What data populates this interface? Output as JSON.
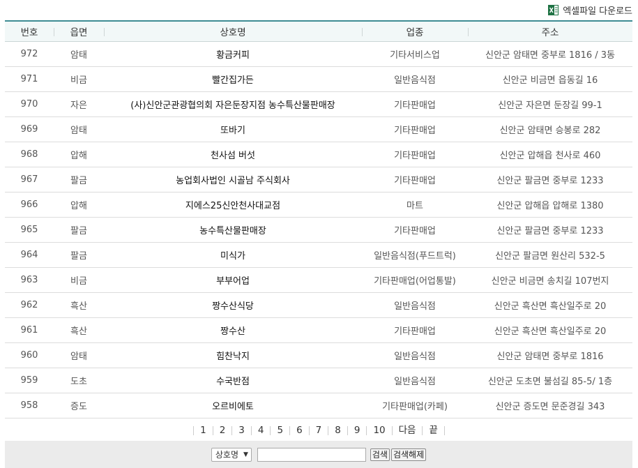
{
  "excel": {
    "label": "엑셀파일 다운로드",
    "icon": "excel-icon",
    "color": "#1f7244"
  },
  "columns": [
    "번호",
    "읍면",
    "상호명",
    "업종",
    "주소"
  ],
  "rows": [
    {
      "num": "972",
      "area": "암태",
      "name": "황금커피",
      "type": "기타서비스업",
      "addr": "신안군 암태면 중부로 1816 / 3동"
    },
    {
      "num": "971",
      "area": "비금",
      "name": "빨간집가든",
      "type": "일반음식점",
      "addr": "신안군 비금면 읍동길 16"
    },
    {
      "num": "970",
      "area": "자은",
      "name": "(사)신안군관광협의회 자은둔장지점 농수특산물판매장",
      "type": "기타판매업",
      "addr": "신안군 자은면 둔장길 99-1"
    },
    {
      "num": "969",
      "area": "암태",
      "name": "또바기",
      "type": "기타판매업",
      "addr": "신안군 암태면 승봉로 282"
    },
    {
      "num": "968",
      "area": "압해",
      "name": "천사섬 버섯",
      "type": "기타판매업",
      "addr": "신안군 압해읍 천사로 460"
    },
    {
      "num": "967",
      "area": "팔금",
      "name": "농업회사법인 시골남 주식회사",
      "type": "기타판매업",
      "addr": "신안군 팔금면 중부로 1233"
    },
    {
      "num": "966",
      "area": "압해",
      "name": "지에스25신안천사대교점",
      "type": "마트",
      "addr": "신안군 압해읍 압해로 1380"
    },
    {
      "num": "965",
      "area": "팔금",
      "name": "농수특산물판매장",
      "type": "기타판매업",
      "addr": "신안군 팔금면 중부로 1233"
    },
    {
      "num": "964",
      "area": "팔금",
      "name": "미식가",
      "type": "일반음식점(푸드트럭)",
      "addr": "신안군 팔금면 원산리 532-5"
    },
    {
      "num": "963",
      "area": "비금",
      "name": "부부어업",
      "type": "기타판매업(어업통발)",
      "addr": "신안군 비금면 송치길 107번지"
    },
    {
      "num": "962",
      "area": "흑산",
      "name": "짱수산식당",
      "type": "일반음식점",
      "addr": "신안군 흑산면 흑산일주로 20"
    },
    {
      "num": "961",
      "area": "흑산",
      "name": "짱수산",
      "type": "기타판매업",
      "addr": "신안군 흑산면 흑산일주로 20"
    },
    {
      "num": "960",
      "area": "암태",
      "name": "힘찬낙지",
      "type": "일반음식점",
      "addr": "신안군 암태면 중부로 1816"
    },
    {
      "num": "959",
      "area": "도초",
      "name": "수국반점",
      "type": "일반음식점",
      "addr": "신안군 도초면 불섬길 85-5/ 1층"
    },
    {
      "num": "958",
      "area": "증도",
      "name": "오르비에토",
      "type": "기타판매업(카페)",
      "addr": "신안군 증도면 문준경길 343"
    }
  ],
  "pager": {
    "pages": [
      "1",
      "2",
      "3",
      "4",
      "5",
      "6",
      "7",
      "8",
      "9",
      "10"
    ],
    "next": "다음",
    "last": "끝"
  },
  "search": {
    "select_value": "상호명",
    "input_value": "",
    "search_label": "검색",
    "reset_label": "검색해제"
  }
}
